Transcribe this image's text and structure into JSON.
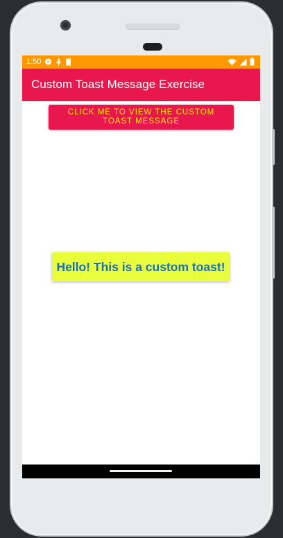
{
  "status_bar": {
    "time": "1:50",
    "background": "#ff9800",
    "left_icons": [
      "chat-notification-icon",
      "mic-icon",
      "sd-card-icon"
    ],
    "right_icons": [
      "wifi-icon",
      "signal-icon",
      "battery-icon"
    ]
  },
  "app_bar": {
    "title": "Custom Toast Message Exercise",
    "background": "#e8184f"
  },
  "main": {
    "button_label": "CLICK ME TO VIEW THE CUSTOM TOAST MESSAGE",
    "button_background": "#e8184f",
    "button_text_color": "#f6f000"
  },
  "toast": {
    "message": "Hello! This is a custom toast!",
    "background": "#eaff3c",
    "text_color": "#1a6fb8"
  },
  "nav_bar": {
    "background": "#000000"
  }
}
